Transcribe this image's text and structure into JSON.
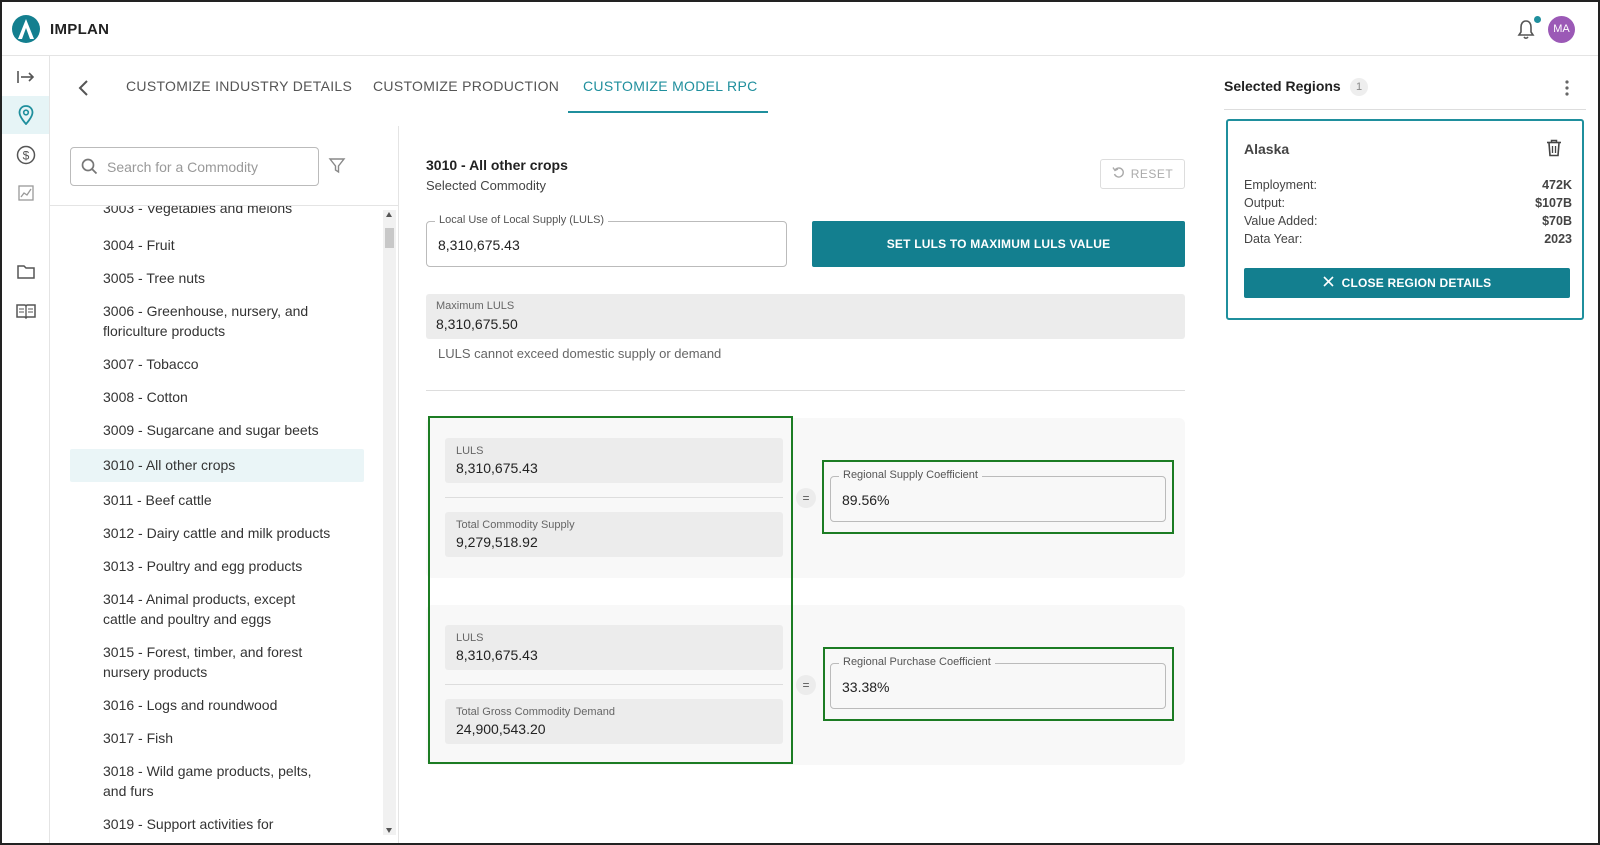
{
  "app": {
    "brand": "IMPLAN",
    "user_initials": "MA"
  },
  "colors": {
    "accent": "#137f8f",
    "accent_light": "#1f8f9d",
    "highlight_green": "#1c7c23",
    "avatar": "#9b59b6"
  },
  "tabs": [
    {
      "label": "CUSTOMIZE INDUSTRY DETAILS",
      "active": false
    },
    {
      "label": "CUSTOMIZE PRODUCTION",
      "active": false
    },
    {
      "label": "CUSTOMIZE MODEL RPC",
      "active": true
    }
  ],
  "search": {
    "placeholder": "Search for a Commodity"
  },
  "commodities": [
    {
      "label": "3003 - Vegetables and melons"
    },
    {
      "label": "3004 - Fruit"
    },
    {
      "label": "3005 - Tree nuts"
    },
    {
      "label": "3006 - Greenhouse, nursery, and floriculture products"
    },
    {
      "label": "3007 - Tobacco"
    },
    {
      "label": "3008 - Cotton"
    },
    {
      "label": "3009 - Sugarcane and sugar beets"
    },
    {
      "label": "3010 - All other crops",
      "selected": true
    },
    {
      "label": "3011 - Beef cattle"
    },
    {
      "label": "3012 - Dairy cattle and milk products"
    },
    {
      "label": "3013 - Poultry and egg products"
    },
    {
      "label": "3014 - Animal products, except cattle and poultry and eggs"
    },
    {
      "label": "3015 - Forest, timber, and forest nursery products"
    },
    {
      "label": "3016 - Logs and roundwood"
    },
    {
      "label": "3017 - Fish"
    },
    {
      "label": "3018 - Wild game products, pelts, and furs"
    },
    {
      "label": "3019 - Support activities for"
    }
  ],
  "main": {
    "selected_title": "3010 - All other crops",
    "selected_sub": "Selected Commodity",
    "reset_label": "RESET",
    "luls_label": "Local Use of Local Supply (LULS)",
    "luls_value": "8,310,675.43",
    "set_button": "SET LULS TO MAXIMUM LULS VALUE",
    "max_label": "Maximum LULS",
    "max_value": "8,310,675.50",
    "note": "LULS cannot exceed domestic supply or demand",
    "supply": {
      "num_label": "LULS",
      "num_value": "8,310,675.43",
      "den_label": "Total Commodity Supply",
      "den_value": "9,279,518.92",
      "eq": "=",
      "result_label": "Regional Supply Coefficient",
      "result_value": "89.56%"
    },
    "purchase": {
      "num_label": "LULS",
      "num_value": "8,310,675.43",
      "den_label": "Total Gross Commodity Demand",
      "den_value": "24,900,543.20",
      "eq": "=",
      "result_label": "Regional Purchase Coefficient",
      "result_value": "33.38%"
    }
  },
  "regions": {
    "title": "Selected Regions",
    "count": "1",
    "card": {
      "name": "Alaska",
      "rows": [
        {
          "label": "Employment:",
          "value": "472K"
        },
        {
          "label": "Output:",
          "value": "$107B"
        },
        {
          "label": "Value Added:",
          "value": "$70B"
        },
        {
          "label": "Data Year:",
          "value": "2023"
        }
      ],
      "close_label": "CLOSE REGION DETAILS"
    }
  }
}
